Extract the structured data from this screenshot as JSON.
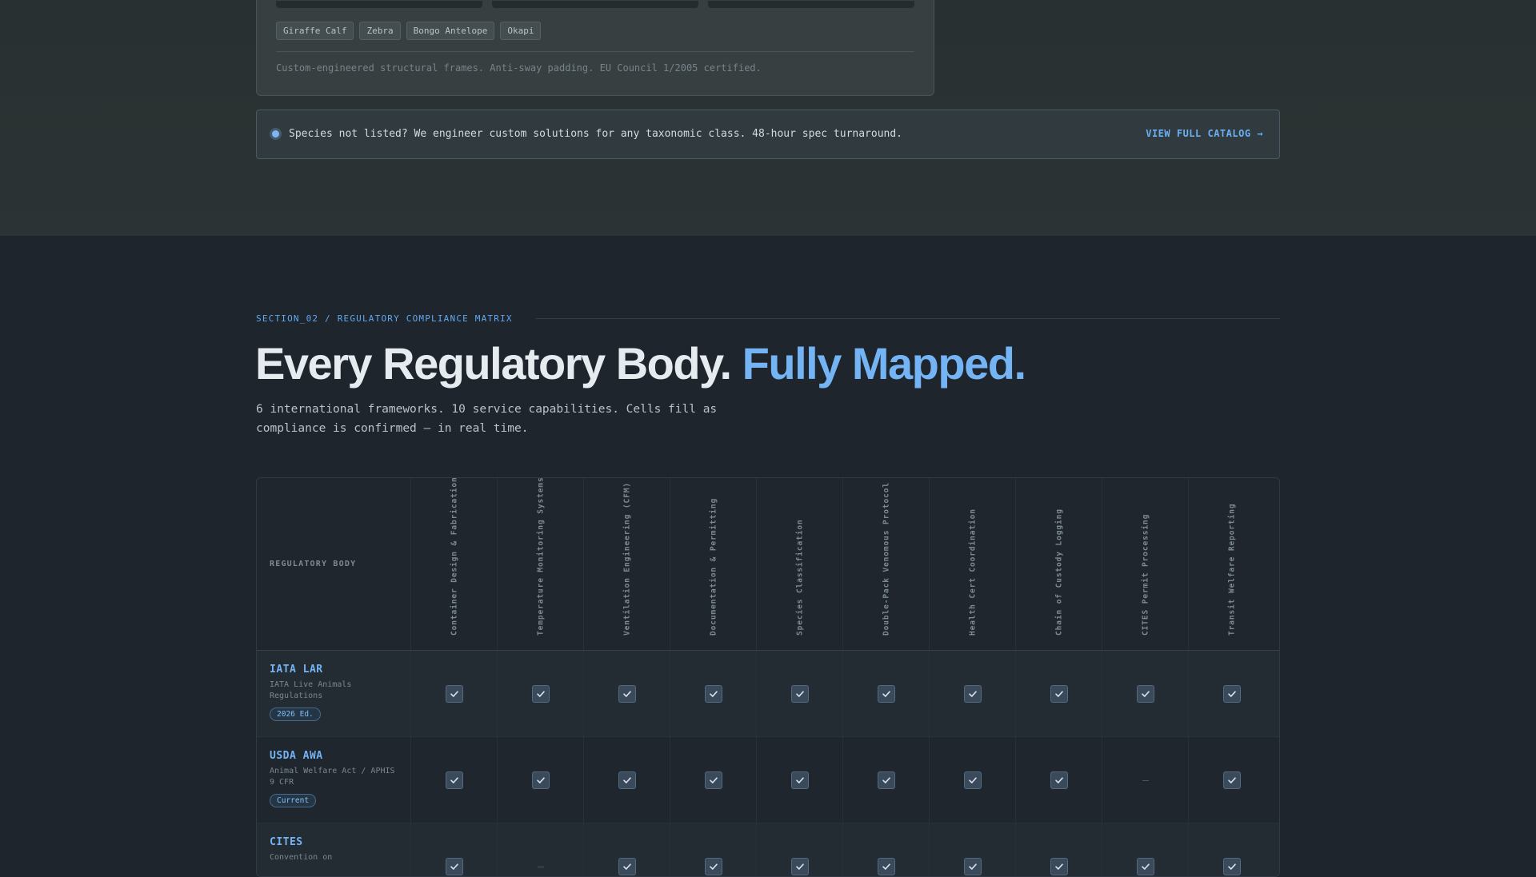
{
  "top_card": {
    "tags": [
      "Giraffe Calf",
      "Zebra",
      "Bongo Antelope",
      "Okapi"
    ],
    "note": "Custom-engineered structural frames. Anti-sway padding. EU Council 1/2005 certified."
  },
  "banner": {
    "text": "Species not listed? We engineer custom solutions for any taxonomic class. 48-hour spec turnaround.",
    "cta": "VIEW FULL CATALOG →"
  },
  "section": {
    "eyebrow": "SECTION_02 / REGULATORY COMPLIANCE MATRIX",
    "headline_main": "Every Regulatory Body.",
    "headline_accent": "Fully Mapped.",
    "subline": "6 international frameworks. 10 service capabilities. Cells fill as compliance is confirmed — in real time."
  },
  "matrix": {
    "row_header_label": "REGULATORY BODY",
    "columns": [
      "Container Design & Fabrication",
      "Temperature Monitoring Systems",
      "Ventilation Engineering (CFM)",
      "Documentation & Permitting",
      "Species Classification",
      "Double-Pack Venomous Protocol",
      "Health Cert Coordination",
      "Chain of Custody Logging",
      "CITES Permit Processing",
      "Transit Welfare Reporting"
    ],
    "rows": [
      {
        "name": "IATA LAR",
        "desc": "IATA Live Animals Regulations",
        "badge": "2026 Ed.",
        "cells": [
          true,
          true,
          true,
          true,
          true,
          true,
          true,
          true,
          true,
          true
        ]
      },
      {
        "name": "USDA AWA",
        "desc": "Animal Welfare Act / APHIS 9 CFR",
        "badge": "Current",
        "cells": [
          true,
          true,
          true,
          true,
          true,
          true,
          true,
          true,
          false,
          true
        ]
      },
      {
        "name": "CITES",
        "desc": "Convention on",
        "badge": "",
        "cells": [
          true,
          false,
          true,
          true,
          true,
          true,
          true,
          true,
          true,
          true
        ]
      }
    ]
  },
  "colors": {
    "accent": "#74b4f4",
    "background": "#1e252d",
    "check_fill": "#3a4a5a"
  }
}
